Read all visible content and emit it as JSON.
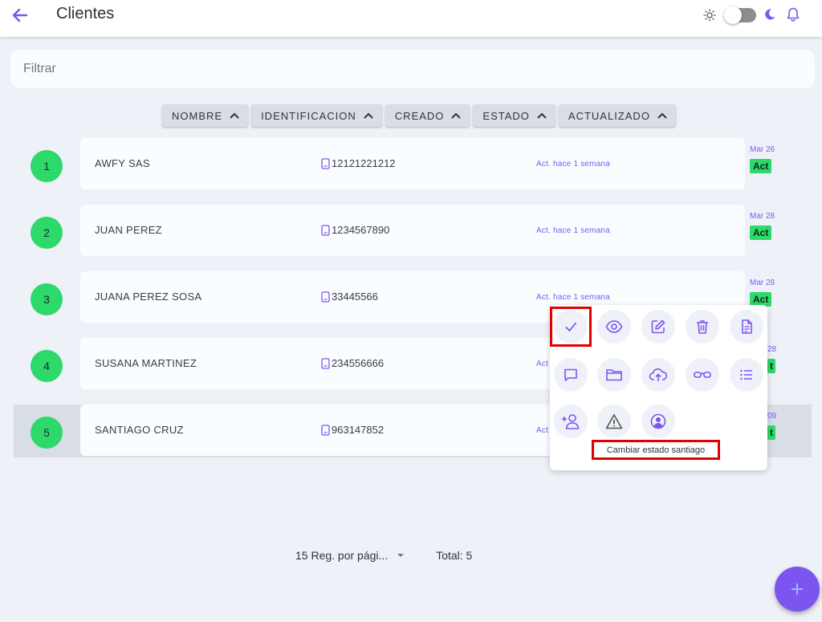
{
  "header": {
    "title": "Clientes"
  },
  "filter": {
    "placeholder": "Filtrar"
  },
  "sort_columns": [
    {
      "label": "NOMBRE"
    },
    {
      "label": "IDENTIFICACION"
    },
    {
      "label": "CREADO"
    },
    {
      "label": "ESTADO"
    },
    {
      "label": "ACTUALIZADO"
    }
  ],
  "rows": [
    {
      "num": "1",
      "name": "AWFY SAS",
      "id": "12121221212",
      "act": "Act. hace 1 semana",
      "date": "Mar 26",
      "status": "Act"
    },
    {
      "num": "2",
      "name": "JUAN PEREZ",
      "id": "1234567890",
      "act": "Act. hace 1 semana",
      "date": "Mar 28",
      "status": "Act"
    },
    {
      "num": "3",
      "name": "JUANA PEREZ SOSA",
      "id": "33445566",
      "act": "Act. hace 1 semana",
      "date": "Mar 28",
      "status": "Act"
    },
    {
      "num": "4",
      "name": "SUSANA MARTINEZ",
      "id": "234556666",
      "act": "Act",
      "date": "28",
      "status": "t"
    },
    {
      "num": "5",
      "name": "SANTIAGO CRUZ",
      "id": "963147852",
      "act": "Act",
      "date": "09",
      "status": "t"
    }
  ],
  "actions_menu": {
    "tooltip": "Cambiar estado santiago",
    "icons": [
      "check-icon",
      "eye-icon",
      "edit-icon",
      "trash-icon",
      "document-icon",
      "comment-icon",
      "folder-icon",
      "cloud-upload-icon",
      "glasses-icon",
      "list-icon",
      "add-user-icon",
      "warning-icon",
      "user-circle-icon"
    ]
  },
  "pagination": {
    "per_page": "15 Reg. por pági...",
    "total": "Total: 5"
  },
  "colors": {
    "accent": "#7c55f0",
    "status_green": "#2dd96a",
    "highlight_frame": "#e10000"
  }
}
